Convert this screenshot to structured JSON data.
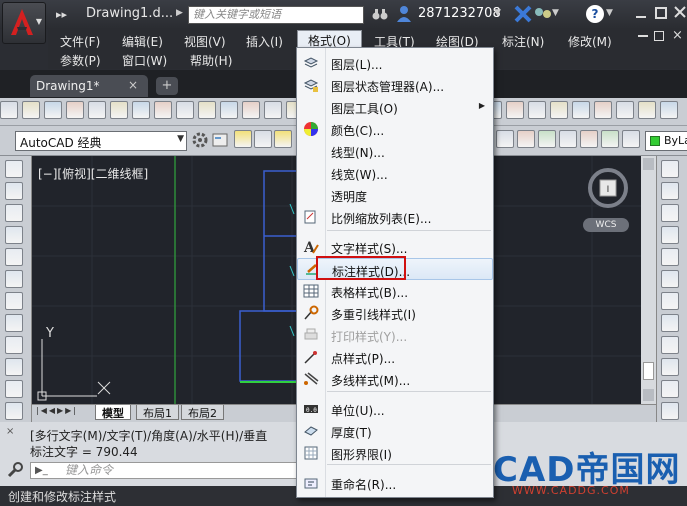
{
  "titlebar": {
    "doc_title": "Drawing1.d...",
    "search_placeholder": "键入关键字或短语",
    "user_id": "2871232708",
    "qa_arrows": "▸▸"
  },
  "menubar": {
    "row1": [
      "文件(F)",
      "编辑(E)",
      "视图(V)",
      "插入(I)",
      "格式(O)",
      "工具(T)",
      "绘图(D)",
      "标注(N)",
      "修改(M)"
    ],
    "row2": [
      "参数(P)",
      "窗口(W)",
      "帮助(H)"
    ]
  },
  "tabs": {
    "drawing": "Drawing1*",
    "close": "×",
    "new": "+"
  },
  "toolbar": {
    "workspace": "AutoCAD 经典",
    "layer_color": "ByLa"
  },
  "canvas": {
    "viewport_label": "[−][俯视][二维线框]",
    "viewcube_label": "I",
    "wcs": "WCS",
    "axis_y": "Y",
    "axis_x": "X"
  },
  "layout_tabs": [
    "模型",
    "布局1",
    "布局2"
  ],
  "command": {
    "line1": "[多行文字(M)/文字(T)/角度(A)/水平(H)/垂直",
    "line2": "标注文字 = 790.44",
    "input_placeholder": "键入命令"
  },
  "status": "创建和修改标注样式",
  "format_menu": {
    "items": [
      {
        "label": "图层(L)...",
        "icon": "layers-icon"
      },
      {
        "label": "图层状态管理器(A)...",
        "icon": "layer-state-icon"
      },
      {
        "label": "图层工具(O)",
        "icon": "",
        "submenu": true
      },
      {
        "label": "颜色(C)...",
        "icon": "color-wheel-icon"
      },
      {
        "label": "线型(N)...",
        "icon": ""
      },
      {
        "label": "线宽(W)...",
        "icon": ""
      },
      {
        "label": "透明度",
        "icon": ""
      },
      {
        "label": "比例缩放列表(E)...",
        "icon": "scale-list-icon"
      },
      {
        "label": "文字样式(S)...",
        "icon": "text-style-icon"
      },
      {
        "label": "标注样式(D)...",
        "icon": "dim-style-icon"
      },
      {
        "label": "表格样式(B)...",
        "icon": "table-style-icon"
      },
      {
        "label": "多重引线样式(I)",
        "icon": "mleader-style-icon"
      },
      {
        "label": "打印样式(Y)...",
        "icon": "plot-style-icon",
        "disabled": true
      },
      {
        "label": "点样式(P)...",
        "icon": "point-style-icon"
      },
      {
        "label": "多线样式(M)...",
        "icon": "mline-style-icon"
      },
      {
        "label": "单位(U)...",
        "icon": "units-icon"
      },
      {
        "label": "厚度(T)",
        "icon": "thickness-icon"
      },
      {
        "label": "图形界限(I)",
        "icon": "limits-icon"
      },
      {
        "label": "重命名(R)...",
        "icon": "rename-icon"
      }
    ]
  },
  "watermark": {
    "text": "CAD帝国网",
    "url": "WWW.CADDG.COM"
  },
  "colors": {
    "accent": "#d01010",
    "brand_blue": "#1a5fb0"
  }
}
